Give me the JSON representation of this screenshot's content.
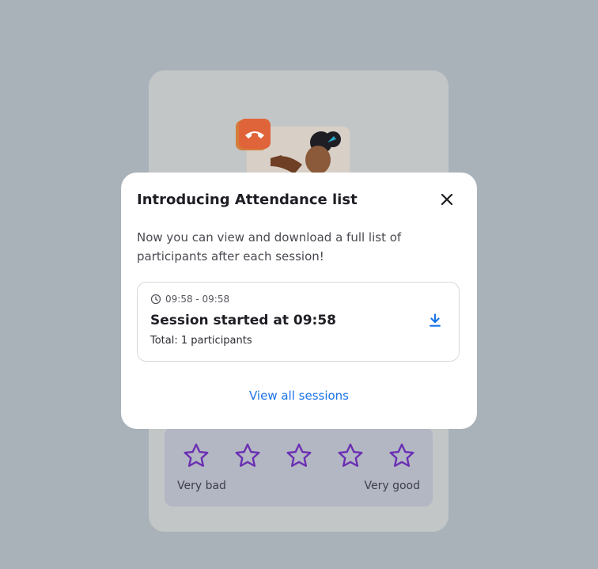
{
  "modal": {
    "title": "Introducing Attendance list",
    "description": "Now you can view and download a full list of participants after each session!",
    "session": {
      "time_range": "09:58 - 09:58",
      "title": "Session started at 09:58",
      "total": "Total: 1 participants"
    },
    "view_all_label": "View all sessions",
    "colors": {
      "link": "#1a73e8",
      "download_icon": "#1a73e8"
    }
  },
  "background": {
    "rating": {
      "low_label": "Very bad",
      "high_label": "Very good",
      "star_count": 5,
      "star_color": "#6b2fb3"
    },
    "illustration": {
      "hangup_icon": "phone-hangup-icon",
      "hangup_color": "#e0643a"
    }
  }
}
